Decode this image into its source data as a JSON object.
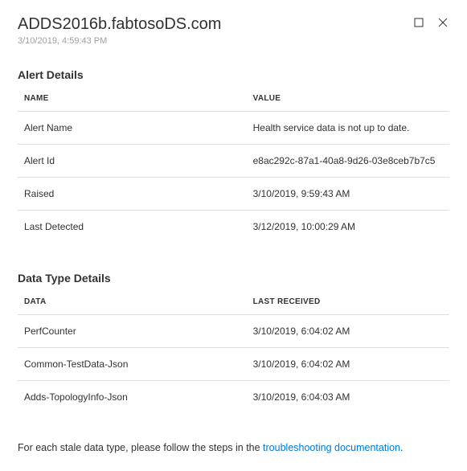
{
  "header": {
    "title": "ADDS2016b.fabtosoDS.com",
    "timestamp": "3/10/2019, 4:59:43 PM"
  },
  "sections": {
    "alert": {
      "heading": "Alert Details",
      "col_name": "NAME",
      "col_value": "VALUE",
      "rows": [
        {
          "name": "Alert Name",
          "value": "Health service data is not up to date."
        },
        {
          "name": "Alert Id",
          "value": "e8ac292c-87a1-40a8-9d26-03e8ceb7b7c5"
        },
        {
          "name": "Raised",
          "value": "3/10/2019, 9:59:43 AM"
        },
        {
          "name": "Last Detected",
          "value": "3/12/2019, 10:00:29 AM"
        }
      ]
    },
    "dataType": {
      "heading": "Data Type Details",
      "col_name": "DATA",
      "col_value": "LAST RECEIVED",
      "rows": [
        {
          "name": "PerfCounter",
          "value": "3/10/2019, 6:04:02 AM"
        },
        {
          "name": "Common-TestData-Json",
          "value": "3/10/2019, 6:04:02 AM"
        },
        {
          "name": "Adds-TopologyInfo-Json",
          "value": "3/10/2019, 6:04:03 AM"
        }
      ]
    }
  },
  "footnote": {
    "prefix": "For each stale data type, please follow the steps in the ",
    "link": "troubleshooting documentation",
    "suffix": "."
  }
}
